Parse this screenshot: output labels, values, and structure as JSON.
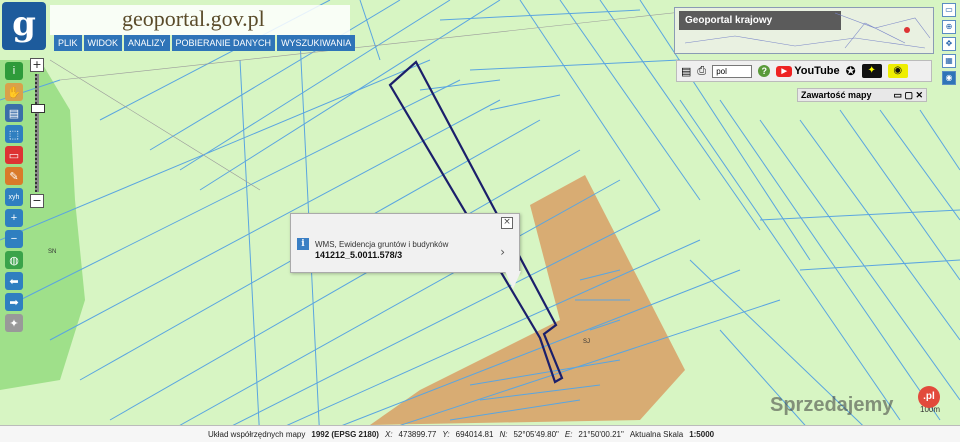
{
  "brand": {
    "logo_letter": "g",
    "site": "geoportal.gov.pl"
  },
  "menu": [
    "PLIK",
    "WIDOK",
    "ANALIZY",
    "POBIERANIE DANYCH",
    "WYSZUKIWANIA"
  ],
  "left_tools": [
    {
      "icon": "info-icon",
      "color": "#2e9b3a",
      "glyph": "i"
    },
    {
      "icon": "pan-hand-icon",
      "color": "#d9a14a",
      "glyph": "✋"
    },
    {
      "icon": "layers-icon",
      "color": "#3b6ea8",
      "glyph": "▤"
    },
    {
      "icon": "select-icon",
      "color": "#2f7fc0",
      "glyph": "⬚"
    },
    {
      "icon": "select-rect-icon",
      "color": "#d33",
      "glyph": "▭"
    },
    {
      "icon": "draw-icon",
      "color": "#d97a2a",
      "glyph": "✎"
    },
    {
      "icon": "xyh-icon",
      "color": "#2f7fc0",
      "glyph": "xyh"
    },
    {
      "icon": "zoom-in-icon",
      "color": "#2f7fc0",
      "glyph": "+"
    },
    {
      "icon": "zoom-out-icon",
      "color": "#2f7fc0",
      "glyph": "−"
    },
    {
      "icon": "globe-icon",
      "color": "#3aa34a",
      "glyph": "◍"
    },
    {
      "icon": "back-arrow-icon",
      "color": "#2f7fc0",
      "glyph": "⬅"
    },
    {
      "icon": "forward-arrow-icon",
      "color": "#2f7fc0",
      "glyph": "➡"
    },
    {
      "icon": "compass-icon",
      "color": "#999999",
      "glyph": "✦"
    }
  ],
  "zoom": {
    "plus": "+",
    "minus": "−"
  },
  "overview": {
    "title": "Geoportal krajowy"
  },
  "right_toolbar": {
    "language": "pol",
    "help": "?",
    "youtube_label": "YouTube"
  },
  "content_panel": {
    "title": "Zawartość mapy"
  },
  "popup": {
    "layer": "WMS, Ewidencja gruntów i budynków",
    "parcel_id": "141212_5.0011.578/3",
    "close": "×",
    "arrow": "›"
  },
  "map_labels": {
    "sn": "SN",
    "sj": "SJ"
  },
  "status": {
    "coord_label": "Układ współrzędnych mapy",
    "coord_system": "1992 (EPSG 2180)",
    "x_label": "X:",
    "x_value": "473899.77",
    "y_label": "Y:",
    "y_value": "694014.81",
    "n_label": "N:",
    "n_value": "52°05'49.80\"",
    "e_label": "E:",
    "e_value": "21°50'00.21\"",
    "scale_label": "Aktualna Skala",
    "scale_value": "1:5000"
  },
  "scale_bar": "100m",
  "watermark": {
    "text": "Sprzedajemy",
    "badge": ".pl"
  },
  "colors": {
    "map_bg": "#d7f5c3",
    "parcel_lines": "#5aa5e0",
    "selected_parcel": "#1b1f6b",
    "forest": "#9fe08a",
    "orange_area": "#d8a46a"
  }
}
